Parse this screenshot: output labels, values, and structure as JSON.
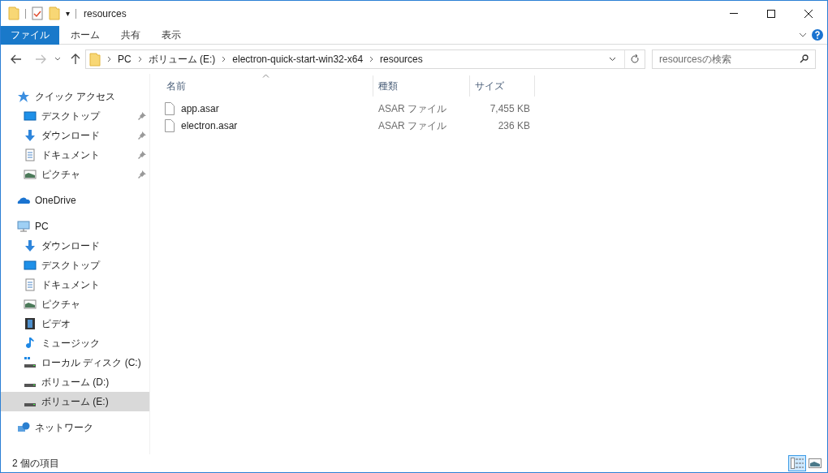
{
  "window": {
    "title": "resources",
    "qat_caret": "▾"
  },
  "ribbon_tabs": [
    {
      "label": "ファイル",
      "selected": true
    },
    {
      "label": "ホーム",
      "selected": false
    },
    {
      "label": "共有",
      "selected": false
    },
    {
      "label": "表示",
      "selected": false
    }
  ],
  "address": {
    "segments": [
      "PC",
      "ボリューム (E:)",
      "electron-quick-start-win32-x64",
      "resources"
    ]
  },
  "search": {
    "placeholder": "resourcesの検索"
  },
  "sidebar": [
    {
      "label": "クイック アクセス",
      "kind": "star",
      "selected": false,
      "children": [
        {
          "label": "デスクトップ",
          "kind": "desktop",
          "pinned": true,
          "selected": false
        },
        {
          "label": "ダウンロード",
          "kind": "download",
          "pinned": true,
          "selected": false
        },
        {
          "label": "ドキュメント",
          "kind": "document",
          "pinned": true,
          "selected": false
        },
        {
          "label": "ピクチャ",
          "kind": "picture",
          "pinned": true,
          "selected": false
        }
      ]
    },
    {
      "label": "OneDrive",
      "kind": "cloud",
      "selected": false
    },
    {
      "label": "PC",
      "kind": "pc",
      "selected": false,
      "children": [
        {
          "label": "ダウンロード",
          "kind": "download",
          "pinned": false,
          "selected": false
        },
        {
          "label": "デスクトップ",
          "kind": "desktop",
          "pinned": false,
          "selected": false
        },
        {
          "label": "ドキュメント",
          "kind": "document",
          "pinned": false,
          "selected": false
        },
        {
          "label": "ピクチャ",
          "kind": "picture",
          "pinned": false,
          "selected": false
        },
        {
          "label": "ビデオ",
          "kind": "video",
          "pinned": false,
          "selected": false
        },
        {
          "label": "ミュージック",
          "kind": "music",
          "pinned": false,
          "selected": false
        },
        {
          "label": "ローカル ディスク (C:)",
          "kind": "system-disk",
          "pinned": false,
          "selected": false
        },
        {
          "label": "ボリューム (D:)",
          "kind": "disk",
          "pinned": false,
          "selected": false
        },
        {
          "label": "ボリューム (E:)",
          "kind": "disk",
          "pinned": false,
          "selected": true
        }
      ]
    },
    {
      "label": "ネットワーク",
      "kind": "network",
      "selected": false
    }
  ],
  "table": {
    "columns": [
      "名前",
      "種類",
      "サイズ"
    ],
    "rows": [
      {
        "name": "app.asar",
        "type": "ASAR ファイル",
        "size": "7,455 KB"
      },
      {
        "name": "electron.asar",
        "type": "ASAR ファイル",
        "size": "236 KB"
      }
    ]
  },
  "status_bar": {
    "text": "2 個の項目",
    "views": [
      {
        "kind": "details",
        "selected": true
      },
      {
        "kind": "thumbnails",
        "selected": false
      }
    ]
  }
}
